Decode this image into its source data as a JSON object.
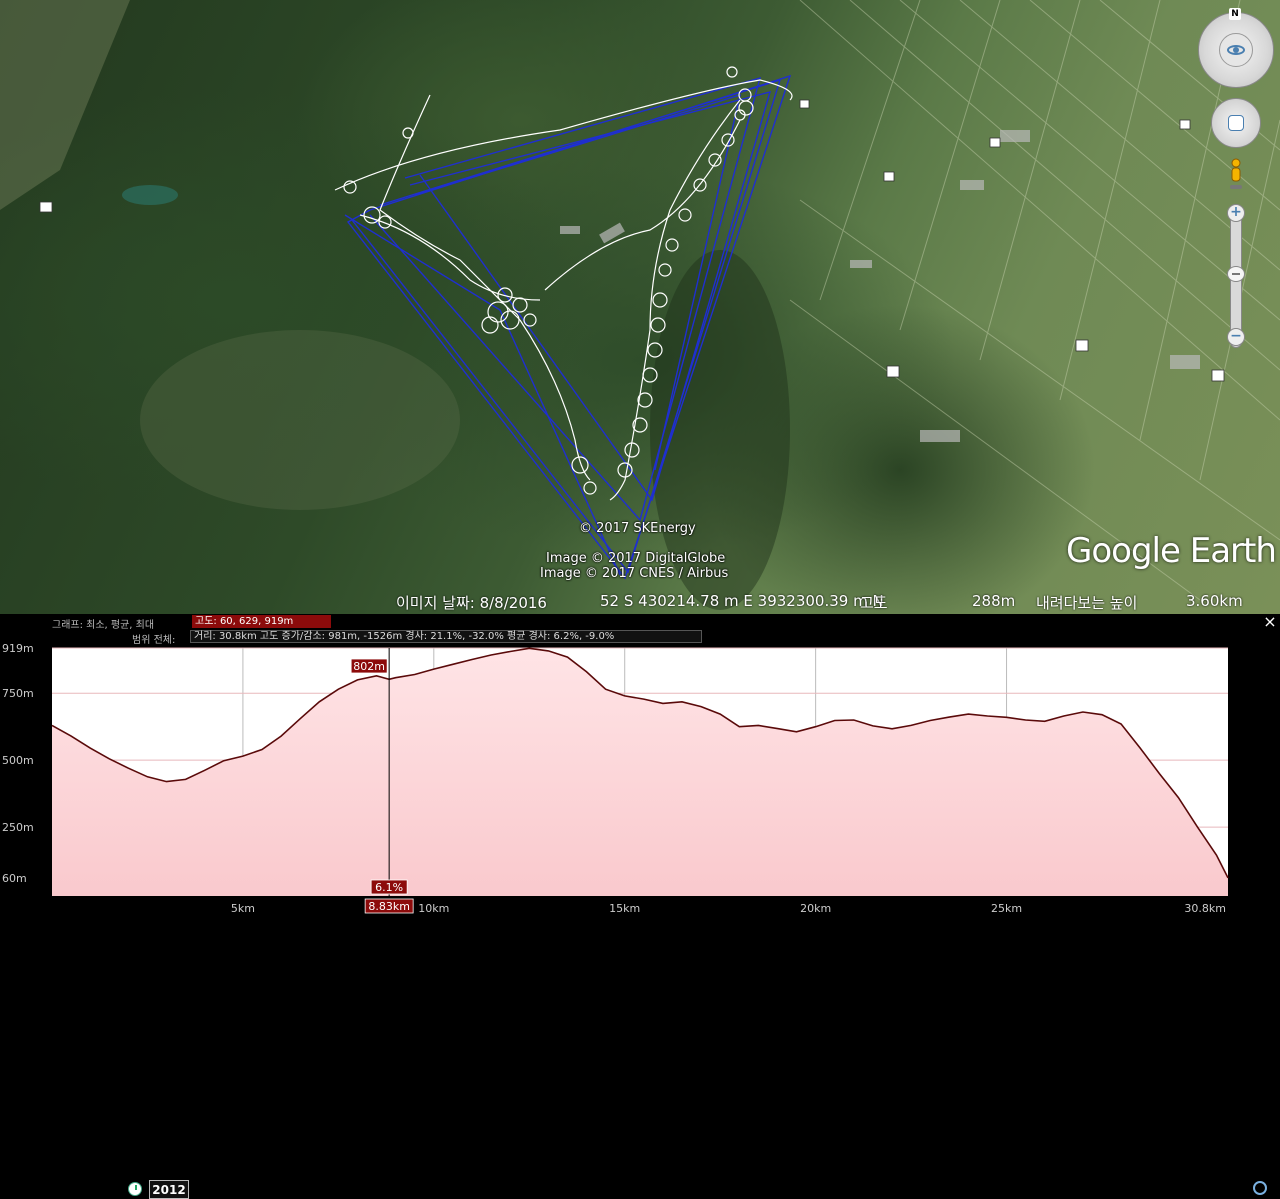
{
  "map": {
    "copyright_sk": "© 2017 SKEnergy",
    "copyright_dg": "Image © 2017 DigitalGlobe",
    "copyright_cnes": "Image © 2017 CNES / Airbus",
    "logo_google": "Google",
    "logo_earth": "Earth",
    "north_label": "N"
  },
  "status": {
    "year": "2012",
    "date": "이미지 날짜: 8/8/2016",
    "coords": "52 S 430214.78 m E 3932300.39 m N",
    "alt_label": "고도",
    "alt_value": "288m",
    "eye_label": "내려다보는 높이",
    "eye_value": "3.60km"
  },
  "profile": {
    "graph_label": "그래프: 최소, 평균, 최대",
    "graph_value": "고도: 60, 629, 919m",
    "range_label": "범위 전체:",
    "range_value": "거리: 30.8km 고도 증가/감소: 981m, -1526m 경사: 21.1%, -32.0% 평균 경사: 6.2%, -9.0%",
    "close_label": "×",
    "cursor_elevation": "802m",
    "cursor_slope": "6.1%",
    "cursor_distance": "8.83km"
  },
  "colors": {
    "fill": "#f9c9cd",
    "line": "#5a0a0a",
    "badge": "#8c0b0b",
    "track_blue": "#1f2fd0",
    "track_white": "#ffffff"
  },
  "chart_data": {
    "type": "area",
    "title": "",
    "xlabel": "",
    "ylabel": "",
    "xlim": [
      0,
      30.8
    ],
    "ylim": [
      0,
      919
    ],
    "x_ticks": [
      "5km",
      "10km",
      "15km",
      "20km",
      "25km",
      "30.8km"
    ],
    "x_tick_values": [
      5,
      10,
      15,
      20,
      25,
      30.8
    ],
    "y_ticks": [
      "919m",
      "750m",
      "500m",
      "250m",
      "60m"
    ],
    "y_tick_values": [
      919,
      750,
      500,
      250,
      60
    ],
    "cursor_x": 8.83,
    "series": [
      {
        "x": [
          0,
          0.5,
          1,
          1.5,
          2,
          2.5,
          3,
          3.5,
          4,
          4.5,
          5,
          5.5,
          6,
          6.5,
          7,
          7.5,
          8,
          8.5,
          8.83,
          9,
          9.5,
          10,
          10.5,
          11,
          11.5,
          12,
          12.5,
          13,
          13.5,
          14,
          14.5,
          15,
          15.5,
          16,
          16.5,
          17,
          17.5,
          18,
          18.5,
          19,
          19.5,
          20,
          20.5,
          21,
          21.5,
          22,
          22.5,
          23,
          23.5,
          24,
          24.5,
          25,
          25.5,
          26,
          26.5,
          27,
          27.5,
          28,
          28.5,
          29,
          29.5,
          30,
          30.5,
          30.8
        ],
        "y": [
          630,
          590,
          545,
          505,
          470,
          438,
          420,
          428,
          462,
          498,
          515,
          540,
          590,
          655,
          718,
          765,
          800,
          815,
          802,
          808,
          820,
          840,
          858,
          876,
          893,
          906,
          918,
          908,
          885,
          830,
          765,
          740,
          728,
          712,
          718,
          700,
          672,
          625,
          630,
          618,
          606,
          625,
          648,
          650,
          628,
          617,
          630,
          648,
          661,
          672,
          665,
          660,
          650,
          645,
          665,
          680,
          670,
          635,
          545,
          450,
          360,
          250,
          145,
          60
        ]
      }
    ]
  }
}
